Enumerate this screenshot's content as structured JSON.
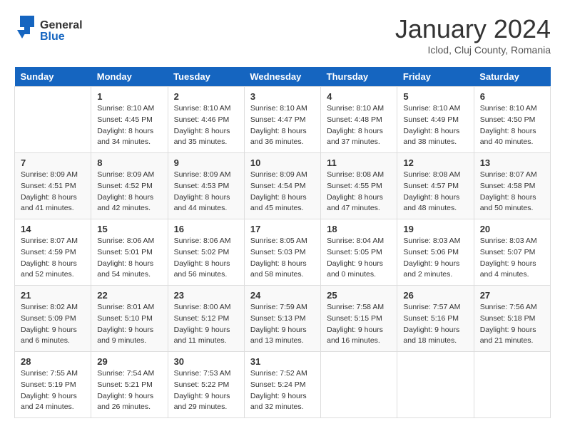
{
  "header": {
    "logo_general": "General",
    "logo_blue": "Blue",
    "month_title": "January 2024",
    "location": "Iclod, Cluj County, Romania"
  },
  "weekdays": [
    "Sunday",
    "Monday",
    "Tuesday",
    "Wednesday",
    "Thursday",
    "Friday",
    "Saturday"
  ],
  "weeks": [
    [
      {
        "day": "",
        "sunrise": "",
        "sunset": "",
        "daylight": ""
      },
      {
        "day": "1",
        "sunrise": "Sunrise: 8:10 AM",
        "sunset": "Sunset: 4:45 PM",
        "daylight": "Daylight: 8 hours and 34 minutes."
      },
      {
        "day": "2",
        "sunrise": "Sunrise: 8:10 AM",
        "sunset": "Sunset: 4:46 PM",
        "daylight": "Daylight: 8 hours and 35 minutes."
      },
      {
        "day": "3",
        "sunrise": "Sunrise: 8:10 AM",
        "sunset": "Sunset: 4:47 PM",
        "daylight": "Daylight: 8 hours and 36 minutes."
      },
      {
        "day": "4",
        "sunrise": "Sunrise: 8:10 AM",
        "sunset": "Sunset: 4:48 PM",
        "daylight": "Daylight: 8 hours and 37 minutes."
      },
      {
        "day": "5",
        "sunrise": "Sunrise: 8:10 AM",
        "sunset": "Sunset: 4:49 PM",
        "daylight": "Daylight: 8 hours and 38 minutes."
      },
      {
        "day": "6",
        "sunrise": "Sunrise: 8:10 AM",
        "sunset": "Sunset: 4:50 PM",
        "daylight": "Daylight: 8 hours and 40 minutes."
      }
    ],
    [
      {
        "day": "7",
        "sunrise": "Sunrise: 8:09 AM",
        "sunset": "Sunset: 4:51 PM",
        "daylight": "Daylight: 8 hours and 41 minutes."
      },
      {
        "day": "8",
        "sunrise": "Sunrise: 8:09 AM",
        "sunset": "Sunset: 4:52 PM",
        "daylight": "Daylight: 8 hours and 42 minutes."
      },
      {
        "day": "9",
        "sunrise": "Sunrise: 8:09 AM",
        "sunset": "Sunset: 4:53 PM",
        "daylight": "Daylight: 8 hours and 44 minutes."
      },
      {
        "day": "10",
        "sunrise": "Sunrise: 8:09 AM",
        "sunset": "Sunset: 4:54 PM",
        "daylight": "Daylight: 8 hours and 45 minutes."
      },
      {
        "day": "11",
        "sunrise": "Sunrise: 8:08 AM",
        "sunset": "Sunset: 4:55 PM",
        "daylight": "Daylight: 8 hours and 47 minutes."
      },
      {
        "day": "12",
        "sunrise": "Sunrise: 8:08 AM",
        "sunset": "Sunset: 4:57 PM",
        "daylight": "Daylight: 8 hours and 48 minutes."
      },
      {
        "day": "13",
        "sunrise": "Sunrise: 8:07 AM",
        "sunset": "Sunset: 4:58 PM",
        "daylight": "Daylight: 8 hours and 50 minutes."
      }
    ],
    [
      {
        "day": "14",
        "sunrise": "Sunrise: 8:07 AM",
        "sunset": "Sunset: 4:59 PM",
        "daylight": "Daylight: 8 hours and 52 minutes."
      },
      {
        "day": "15",
        "sunrise": "Sunrise: 8:06 AM",
        "sunset": "Sunset: 5:01 PM",
        "daylight": "Daylight: 8 hours and 54 minutes."
      },
      {
        "day": "16",
        "sunrise": "Sunrise: 8:06 AM",
        "sunset": "Sunset: 5:02 PM",
        "daylight": "Daylight: 8 hours and 56 minutes."
      },
      {
        "day": "17",
        "sunrise": "Sunrise: 8:05 AM",
        "sunset": "Sunset: 5:03 PM",
        "daylight": "Daylight: 8 hours and 58 minutes."
      },
      {
        "day": "18",
        "sunrise": "Sunrise: 8:04 AM",
        "sunset": "Sunset: 5:05 PM",
        "daylight": "Daylight: 9 hours and 0 minutes."
      },
      {
        "day": "19",
        "sunrise": "Sunrise: 8:03 AM",
        "sunset": "Sunset: 5:06 PM",
        "daylight": "Daylight: 9 hours and 2 minutes."
      },
      {
        "day": "20",
        "sunrise": "Sunrise: 8:03 AM",
        "sunset": "Sunset: 5:07 PM",
        "daylight": "Daylight: 9 hours and 4 minutes."
      }
    ],
    [
      {
        "day": "21",
        "sunrise": "Sunrise: 8:02 AM",
        "sunset": "Sunset: 5:09 PM",
        "daylight": "Daylight: 9 hours and 6 minutes."
      },
      {
        "day": "22",
        "sunrise": "Sunrise: 8:01 AM",
        "sunset": "Sunset: 5:10 PM",
        "daylight": "Daylight: 9 hours and 9 minutes."
      },
      {
        "day": "23",
        "sunrise": "Sunrise: 8:00 AM",
        "sunset": "Sunset: 5:12 PM",
        "daylight": "Daylight: 9 hours and 11 minutes."
      },
      {
        "day": "24",
        "sunrise": "Sunrise: 7:59 AM",
        "sunset": "Sunset: 5:13 PM",
        "daylight": "Daylight: 9 hours and 13 minutes."
      },
      {
        "day": "25",
        "sunrise": "Sunrise: 7:58 AM",
        "sunset": "Sunset: 5:15 PM",
        "daylight": "Daylight: 9 hours and 16 minutes."
      },
      {
        "day": "26",
        "sunrise": "Sunrise: 7:57 AM",
        "sunset": "Sunset: 5:16 PM",
        "daylight": "Daylight: 9 hours and 18 minutes."
      },
      {
        "day": "27",
        "sunrise": "Sunrise: 7:56 AM",
        "sunset": "Sunset: 5:18 PM",
        "daylight": "Daylight: 9 hours and 21 minutes."
      }
    ],
    [
      {
        "day": "28",
        "sunrise": "Sunrise: 7:55 AM",
        "sunset": "Sunset: 5:19 PM",
        "daylight": "Daylight: 9 hours and 24 minutes."
      },
      {
        "day": "29",
        "sunrise": "Sunrise: 7:54 AM",
        "sunset": "Sunset: 5:21 PM",
        "daylight": "Daylight: 9 hours and 26 minutes."
      },
      {
        "day": "30",
        "sunrise": "Sunrise: 7:53 AM",
        "sunset": "Sunset: 5:22 PM",
        "daylight": "Daylight: 9 hours and 29 minutes."
      },
      {
        "day": "31",
        "sunrise": "Sunrise: 7:52 AM",
        "sunset": "Sunset: 5:24 PM",
        "daylight": "Daylight: 9 hours and 32 minutes."
      },
      {
        "day": "",
        "sunrise": "",
        "sunset": "",
        "daylight": ""
      },
      {
        "day": "",
        "sunrise": "",
        "sunset": "",
        "daylight": ""
      },
      {
        "day": "",
        "sunrise": "",
        "sunset": "",
        "daylight": ""
      }
    ]
  ]
}
